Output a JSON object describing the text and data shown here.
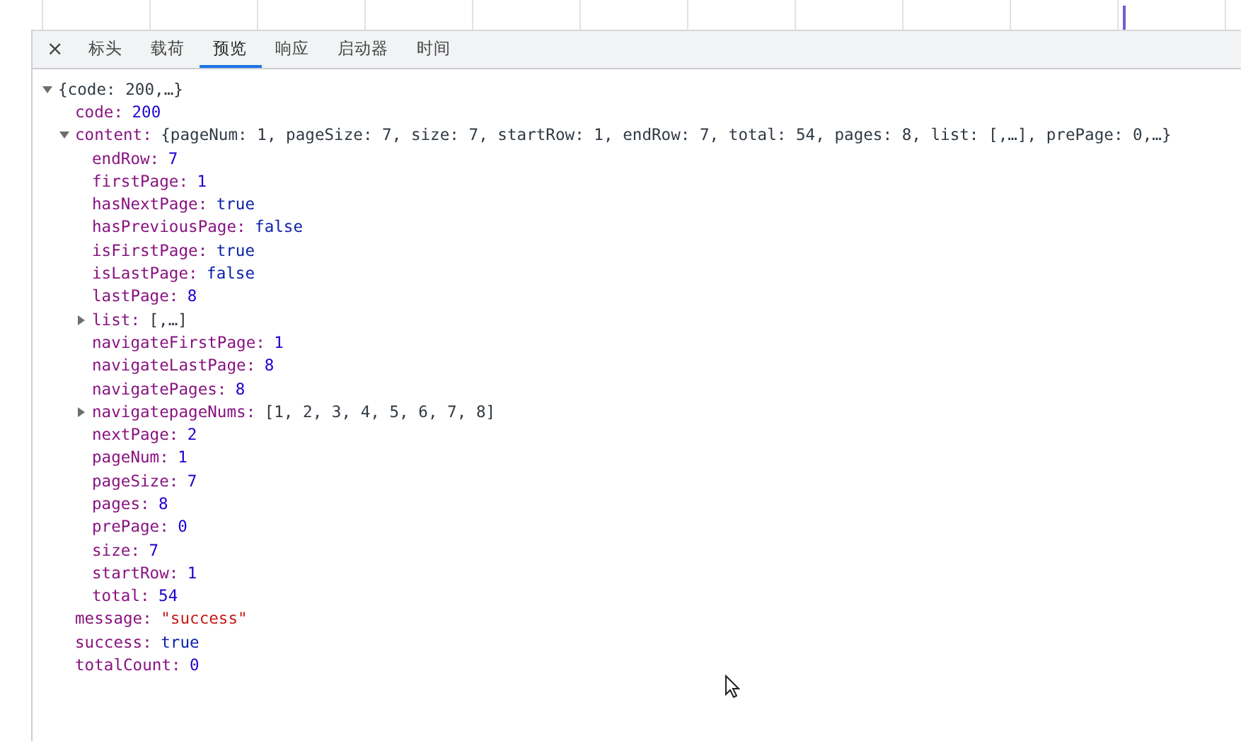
{
  "tabs": [
    {
      "label": "标头",
      "selected": false
    },
    {
      "label": "载荷",
      "selected": false
    },
    {
      "label": "预览",
      "selected": true
    },
    {
      "label": "响应",
      "selected": false
    },
    {
      "label": "启动器",
      "selected": false
    },
    {
      "label": "时间",
      "selected": false
    }
  ],
  "close_button": {
    "label": "×"
  },
  "tree": [
    {
      "value": "{code: 200,…}",
      "kind": "object",
      "expanded": true,
      "children": [
        {
          "key": "code:",
          "value": "200",
          "kind": "number"
        },
        {
          "key": "content:",
          "value": "{pageNum: 1, pageSize: 7, size: 7, startRow: 1, endRow: 7, total: 54, pages: 8, list: [,…], prePage: 0,…}",
          "kind": "object",
          "expanded": true,
          "children": [
            {
              "key": "endRow:",
              "value": "7",
              "kind": "number"
            },
            {
              "key": "firstPage:",
              "value": "1",
              "kind": "number"
            },
            {
              "key": "hasNextPage:",
              "value": "true",
              "kind": "boolean"
            },
            {
              "key": "hasPreviousPage:",
              "value": "false",
              "kind": "boolean"
            },
            {
              "key": "isFirstPage:",
              "value": "true",
              "kind": "boolean"
            },
            {
              "key": "isLastPage:",
              "value": "false",
              "kind": "boolean"
            },
            {
              "key": "lastPage:",
              "value": "8",
              "kind": "number"
            },
            {
              "key": "list:",
              "value": "[,…]",
              "kind": "object",
              "expanded": false
            },
            {
              "key": "navigateFirstPage:",
              "value": "1",
              "kind": "number"
            },
            {
              "key": "navigateLastPage:",
              "value": "8",
              "kind": "number"
            },
            {
              "key": "navigatePages:",
              "value": "8",
              "kind": "number"
            },
            {
              "key": "navigatepageNums:",
              "value": "[1, 2, 3, 4, 5, 6, 7, 8]",
              "kind": "object",
              "expanded": false
            },
            {
              "key": "nextPage:",
              "value": "2",
              "kind": "number"
            },
            {
              "key": "pageNum:",
              "value": "1",
              "kind": "number"
            },
            {
              "key": "pageSize:",
              "value": "7",
              "kind": "number"
            },
            {
              "key": "pages:",
              "value": "8",
              "kind": "number"
            },
            {
              "key": "prePage:",
              "value": "0",
              "kind": "number"
            },
            {
              "key": "size:",
              "value": "7",
              "kind": "number"
            },
            {
              "key": "startRow:",
              "value": "1",
              "kind": "number"
            },
            {
              "key": "total:",
              "value": "54",
              "kind": "number"
            }
          ]
        },
        {
          "key": "message:",
          "value": "\"success\"",
          "kind": "string"
        },
        {
          "key": "success:",
          "value": "true",
          "kind": "boolean"
        },
        {
          "key": "totalCount:",
          "value": "0",
          "kind": "number"
        }
      ]
    }
  ]
}
